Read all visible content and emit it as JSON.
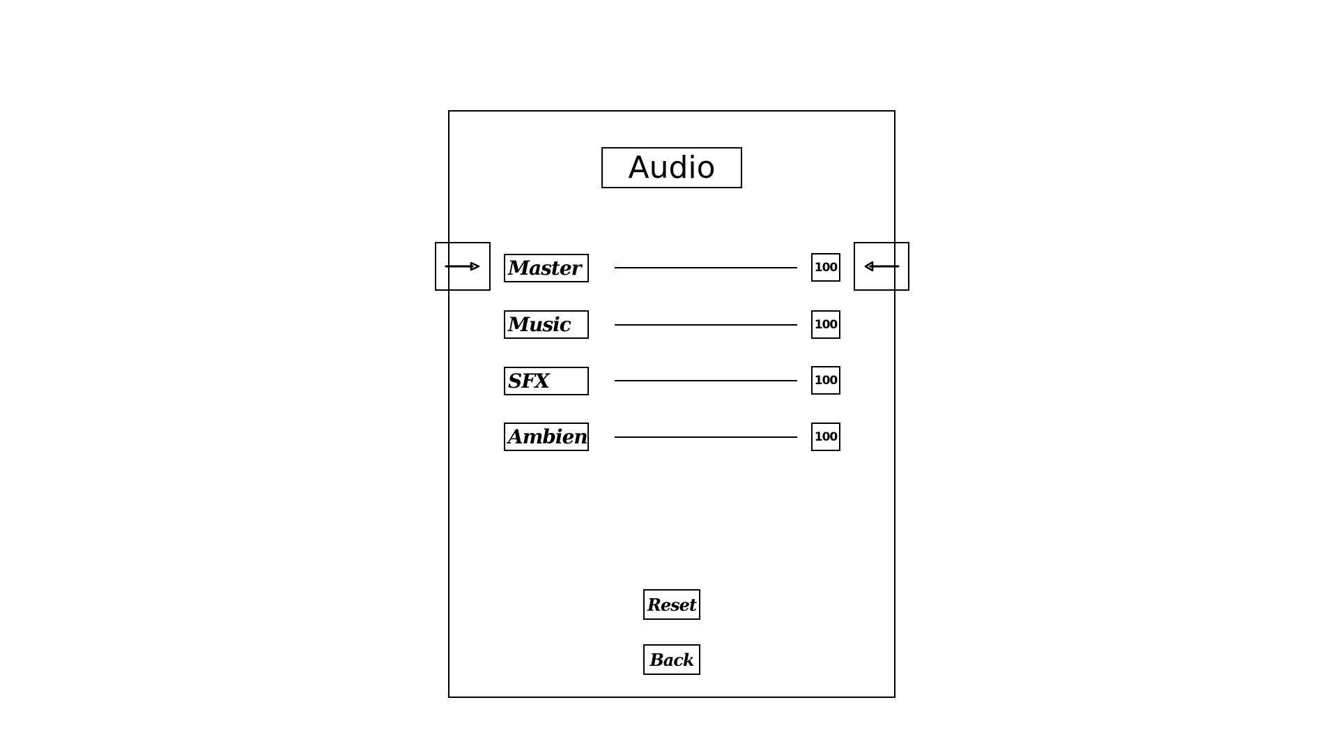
{
  "screen": {
    "title": "Audio"
  },
  "selector": {
    "left_icon": "arrow-right-icon",
    "right_icon": "arrow-left-icon"
  },
  "settings": [
    {
      "label": "Master",
      "value": "100"
    },
    {
      "label": "Music",
      "value": "100"
    },
    {
      "label": "SFX",
      "value": "100"
    },
    {
      "label": "Ambience",
      "value": "100"
    }
  ],
  "buttons": {
    "reset_label": "Reset",
    "back_label": "Back"
  }
}
